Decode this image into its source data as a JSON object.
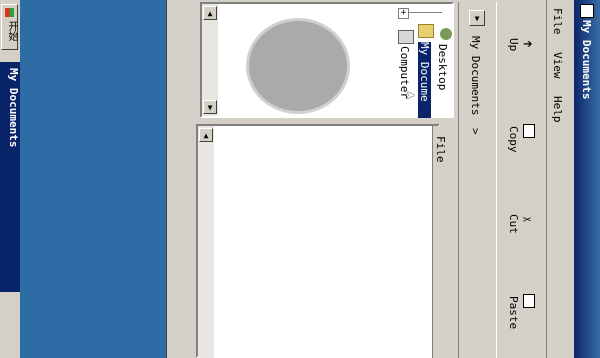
{
  "taskbar": {
    "start_label": "开始",
    "task_label": "My Documents"
  },
  "window": {
    "title": "My Documents",
    "menu": [
      "File",
      "View",
      "Help"
    ],
    "toolbar": {
      "up": "Up",
      "copy": "Copy",
      "cut": "Cut",
      "paste": "Paste"
    },
    "address": "My Documents",
    "tree": {
      "desktop": "Desktop",
      "my_documents": "My Docume",
      "computer": "Computer"
    },
    "list_header": "File"
  }
}
